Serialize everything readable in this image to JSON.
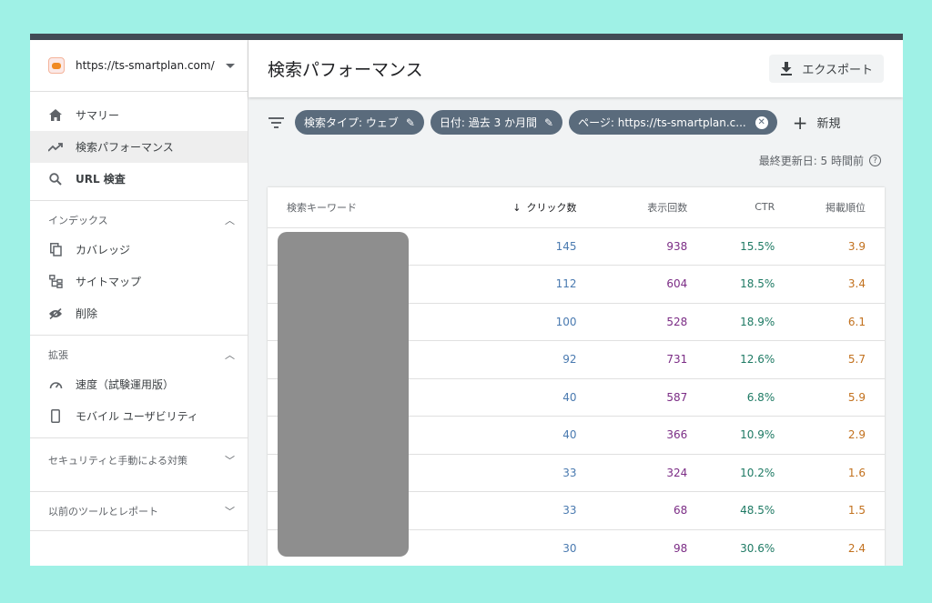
{
  "property": {
    "url": "https://ts-smartplan.com/"
  },
  "nav_top": [
    {
      "label": "サマリー",
      "icon": "home-icon"
    },
    {
      "label": "検索パフォーマンス",
      "icon": "trending-up-icon",
      "active": true
    },
    {
      "label": "URL 検査",
      "icon": "search-icon"
    }
  ],
  "sections": {
    "index": {
      "title": "インデックス",
      "items": [
        {
          "label": "カバレッジ",
          "icon": "copy-icon"
        },
        {
          "label": "サイトマップ",
          "icon": "sitemap-icon"
        },
        {
          "label": "削除",
          "icon": "eye-off-icon"
        }
      ]
    },
    "enhancements": {
      "title": "拡張",
      "items": [
        {
          "label": "速度（試験運用版）",
          "icon": "speedometer-icon"
        },
        {
          "label": "モバイル ユーザビリティ",
          "icon": "phone-icon"
        }
      ]
    },
    "security": {
      "title": "セキュリティと手動による対策"
    },
    "legacy": {
      "title": "以前のツールとレポート"
    }
  },
  "header": {
    "title": "検索パフォーマンス",
    "export_label": "エクスポート"
  },
  "filters": {
    "chips": [
      {
        "label": "検索タイプ: ウェブ"
      },
      {
        "label": "日付: 過去 3 か月間"
      },
      {
        "label": "ページ: https://ts-smartplan.c..."
      }
    ],
    "new_label": "新規",
    "last_updated": "最終更新日: 5 時間前"
  },
  "table": {
    "columns": {
      "keyword": "検索キーワード",
      "clicks": "クリック数",
      "impressions": "表示回数",
      "ctr": "CTR",
      "position": "掲載順位"
    },
    "rows": [
      {
        "clicks": "145",
        "impressions": "938",
        "ctr": "15.5%",
        "position": "3.9"
      },
      {
        "clicks": "112",
        "impressions": "604",
        "ctr": "18.5%",
        "position": "3.4"
      },
      {
        "clicks": "100",
        "impressions": "528",
        "ctr": "18.9%",
        "position": "6.1"
      },
      {
        "clicks": "92",
        "impressions": "731",
        "ctr": "12.6%",
        "position": "5.7"
      },
      {
        "clicks": "40",
        "impressions": "587",
        "ctr": "6.8%",
        "position": "5.9"
      },
      {
        "clicks": "40",
        "impressions": "366",
        "ctr": "10.9%",
        "position": "2.9"
      },
      {
        "clicks": "33",
        "impressions": "324",
        "ctr": "10.2%",
        "position": "1.6"
      },
      {
        "clicks": "33",
        "impressions": "68",
        "ctr": "48.5%",
        "position": "1.5"
      },
      {
        "clicks": "30",
        "impressions": "98",
        "ctr": "30.6%",
        "position": "2.4"
      }
    ]
  },
  "colors": {
    "chip": "#5a6b7c",
    "clicks": "#4a7ab0",
    "impressions": "#7b2c85",
    "ctr": "#1e7a64",
    "position": "#c2711e",
    "background": "#9ff1e6"
  }
}
